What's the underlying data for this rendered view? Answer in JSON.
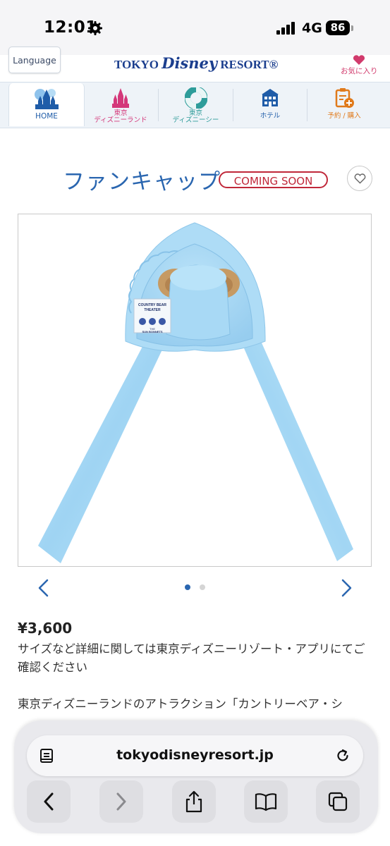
{
  "status_bar": {
    "time": "12:01",
    "network": "4G",
    "battery": "86"
  },
  "header": {
    "language_label": "Language",
    "logo_text_before": "TOKYO ",
    "logo_text_disney": "Disney",
    "logo_text_after": " RESORT®",
    "favorites_label": "お気に入り"
  },
  "nav": {
    "tabs": [
      {
        "label": "HOME",
        "icon": "castle-icon",
        "color": "#1f5ca8",
        "active": true
      },
      {
        "label_line1": "東京",
        "label_line2": "ディズニーランド",
        "icon": "castle-pink-icon",
        "color": "#d4387a"
      },
      {
        "label_line1": "東京",
        "label_line2": "ディズニーシー",
        "icon": "lifebuoy-icon",
        "color": "#2e9c9a"
      },
      {
        "label": "ホテル",
        "icon": "hotel-icon",
        "color": "#1f5ca8"
      },
      {
        "label": "予約 / 購入",
        "icon": "reservation-icon",
        "color": "#e07a1b"
      }
    ]
  },
  "product": {
    "title": "ファンキャップ",
    "badge": "COMING SOON",
    "image_alt_text": [
      "COUNTRY BEAR",
      "THEATER",
      "THE",
      "SUN BONNETS"
    ],
    "price": "¥3,600",
    "note": "サイズなど詳細に関しては東京ディズニーリゾート・アプリにてご確認ください",
    "description": "東京ディズニーランドのアトラクション「カントリーベア・シ"
  },
  "carousel": {
    "total": 2,
    "current": 1
  },
  "browser": {
    "url": "tokyodisneyresort.jp"
  },
  "colors": {
    "brand_blue": "#1b3e8e",
    "title_blue": "#2a66b0",
    "badge_red": "#c0283a",
    "cap_blue": "#a9d8f3"
  }
}
